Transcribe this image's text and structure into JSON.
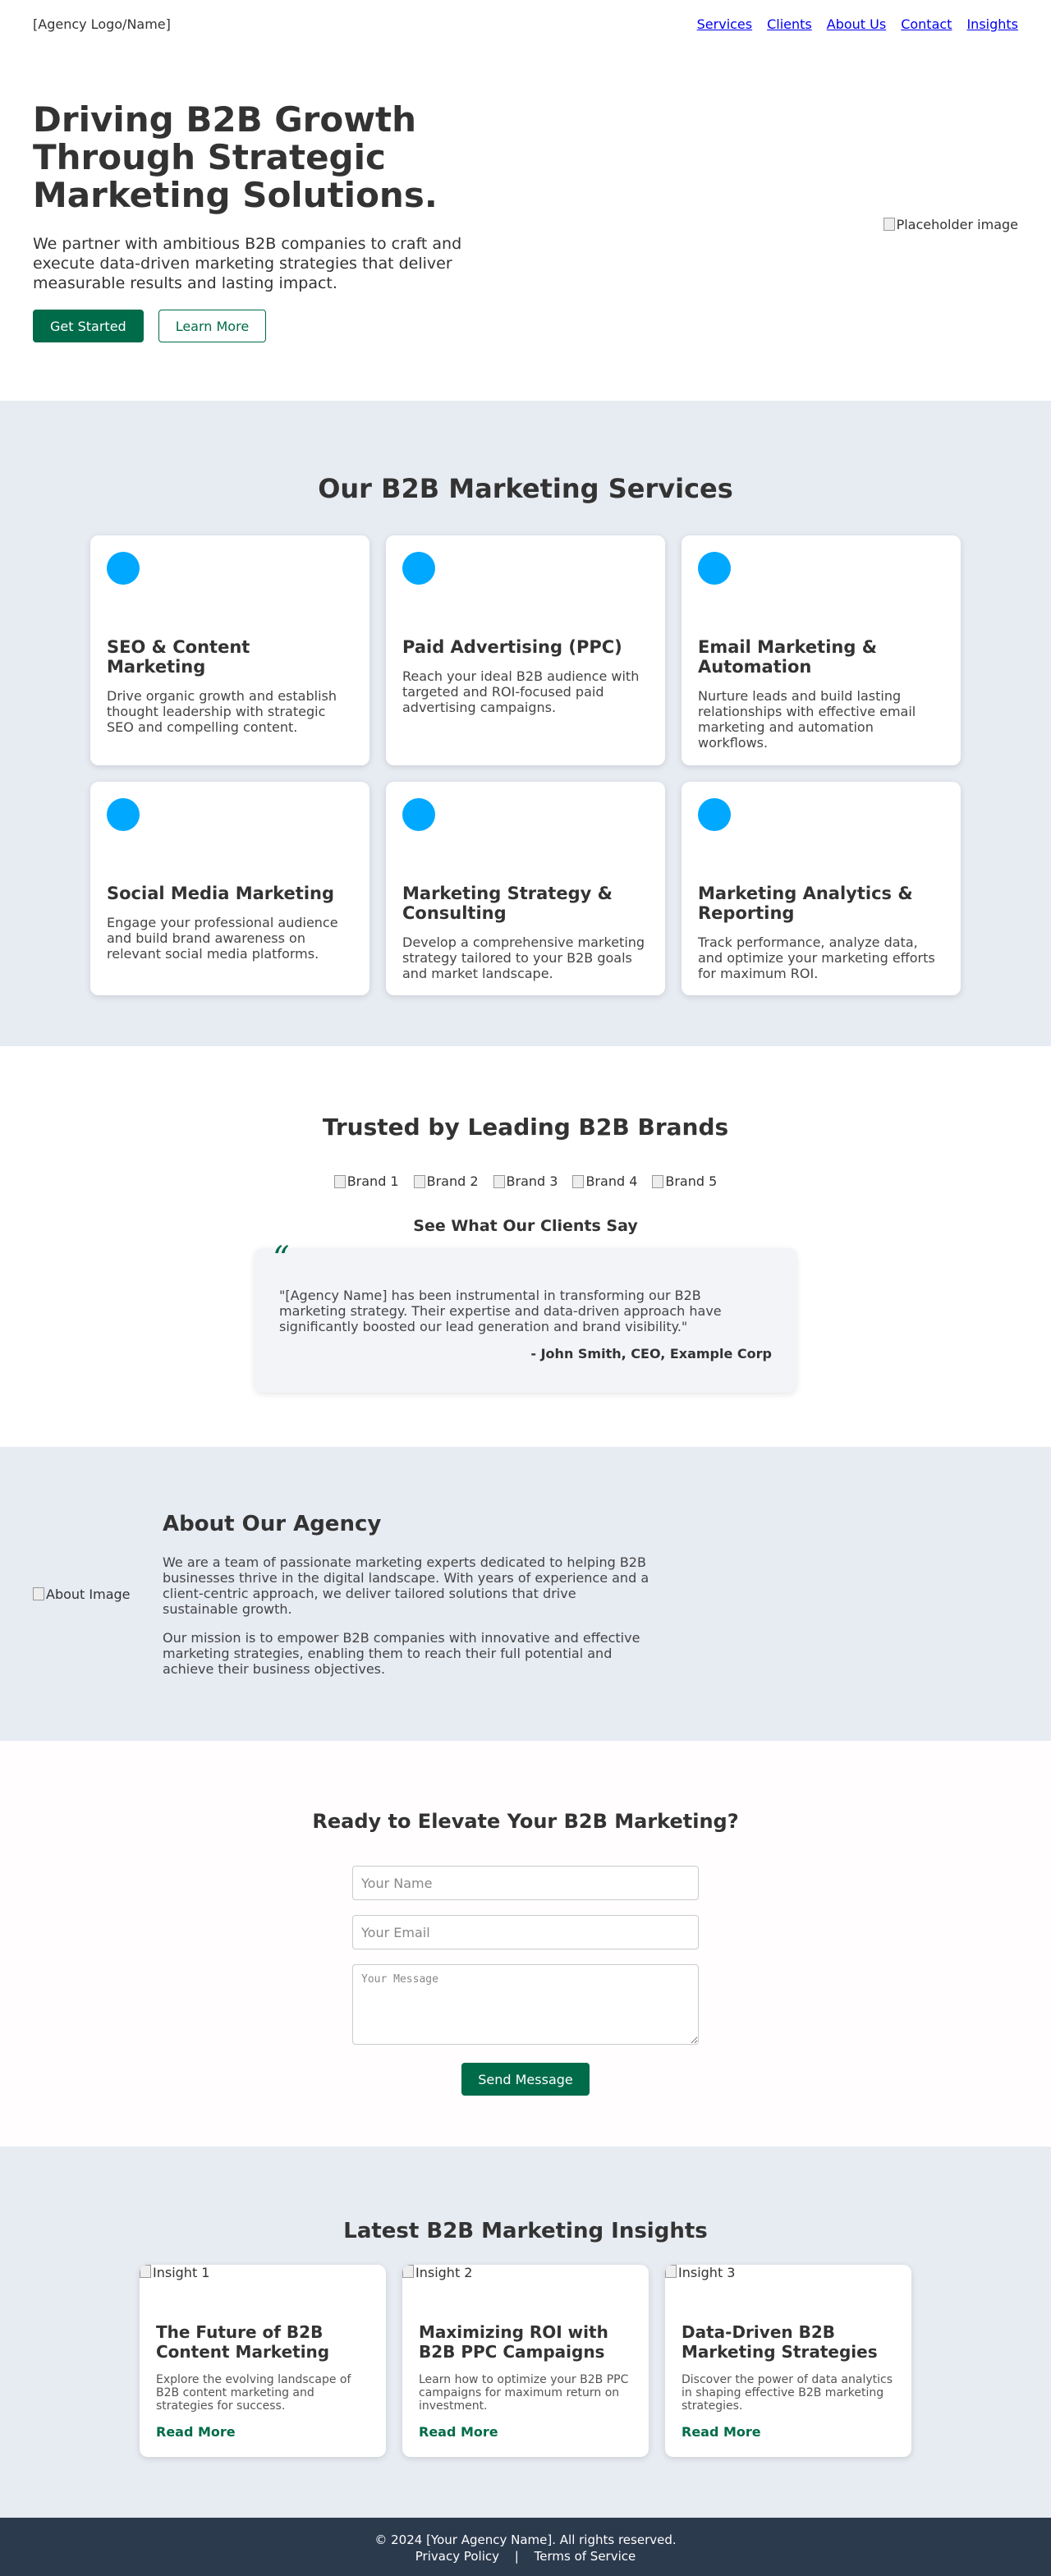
{
  "header": {
    "logo": "[Agency Logo/Name]",
    "nav": [
      "Services",
      "Clients",
      "About Us",
      "Contact",
      "Insights"
    ]
  },
  "hero": {
    "title": "Driving B2B Growth Through Strategic Marketing Solutions.",
    "subtitle": "We partner with ambitious B2B companies to craft and execute data-driven marketing strategies that deliver measurable results and lasting impact.",
    "primary_button": "Get Started",
    "secondary_button": "Learn More",
    "image_alt": "Placeholder image"
  },
  "services": {
    "title": "Our B2B Marketing Services",
    "icon_color": "#00a8ff",
    "items": [
      {
        "title": "SEO & Content Marketing",
        "desc": "Drive organic growth and establish thought leadership with strategic SEO and compelling content."
      },
      {
        "title": "Paid Advertising (PPC)",
        "desc": "Reach your ideal B2B audience with targeted and ROI-focused paid advertising campaigns."
      },
      {
        "title": "Email Marketing & Automation",
        "desc": "Nurture leads and build lasting relationships with effective email marketing and automation workflows."
      },
      {
        "title": "Social Media Marketing",
        "desc": "Engage your professional audience and build brand awareness on relevant social media platforms."
      },
      {
        "title": "Marketing Strategy & Consulting",
        "desc": "Develop a comprehensive marketing strategy tailored to your B2B goals and market landscape."
      },
      {
        "title": "Marketing Analytics & Reporting",
        "desc": "Track performance, analyze data, and optimize your marketing efforts for maximum ROI."
      }
    ]
  },
  "trusted": {
    "title": "Trusted by Leading B2B Brands",
    "brands": [
      "Brand 1",
      "Brand 2",
      "Brand 3",
      "Brand 4",
      "Brand 5"
    ],
    "testimonial_title": "See What Our Clients Say",
    "quote_mark": "“",
    "quote": "\"[Agency Name] has been instrumental in transforming our B2B marketing strategy. Their expertise and data-driven approach have significantly boosted our lead generation and brand visibility.\"",
    "author": "- John Smith, CEO, Example Corp"
  },
  "about": {
    "image_alt": "About Image",
    "title": "About Our Agency",
    "paragraph1": "We are a team of passionate marketing experts dedicated to helping B2B businesses thrive in the digital landscape. With years of experience and a client-centric approach, we deliver tailored solutions that drive sustainable growth.",
    "paragraph2": "Our mission is to empower B2B companies with innovative and effective marketing strategies, enabling them to reach their full potential and achieve their business objectives."
  },
  "contact": {
    "title": "Ready to Elevate Your B2B Marketing?",
    "name_placeholder": "Your Name",
    "email_placeholder": "Your Email",
    "message_placeholder": "Your Message",
    "submit": "Send Message"
  },
  "insights": {
    "title": "Latest B2B Marketing Insights",
    "items": [
      {
        "image_alt": "Insight 1",
        "title": "The Future of B2B Content Marketing",
        "desc": "Explore the evolving landscape of B2B content marketing and strategies for success.",
        "link": "Read More"
      },
      {
        "image_alt": "Insight 2",
        "title": "Maximizing ROI with B2B PPC Campaigns",
        "desc": "Learn how to optimize your B2B PPC campaigns for maximum return on investment.",
        "link": "Read More"
      },
      {
        "image_alt": "Insight 3",
        "title": "Data-Driven B2B Marketing Strategies",
        "desc": "Discover the power of data analytics in shaping effective B2B marketing strategies.",
        "link": "Read More"
      }
    ]
  },
  "footer": {
    "copyright": "© 2024 [Your Agency Name]. All rights reserved.",
    "privacy": "Privacy Policy",
    "separator": "|",
    "terms": "Terms of Service"
  },
  "colors": {
    "brand_green": "#006b49",
    "section_bg": "#e7ebf2",
    "footer_bg": "#2c3a4e",
    "icon_blue": "#00a8ff"
  }
}
